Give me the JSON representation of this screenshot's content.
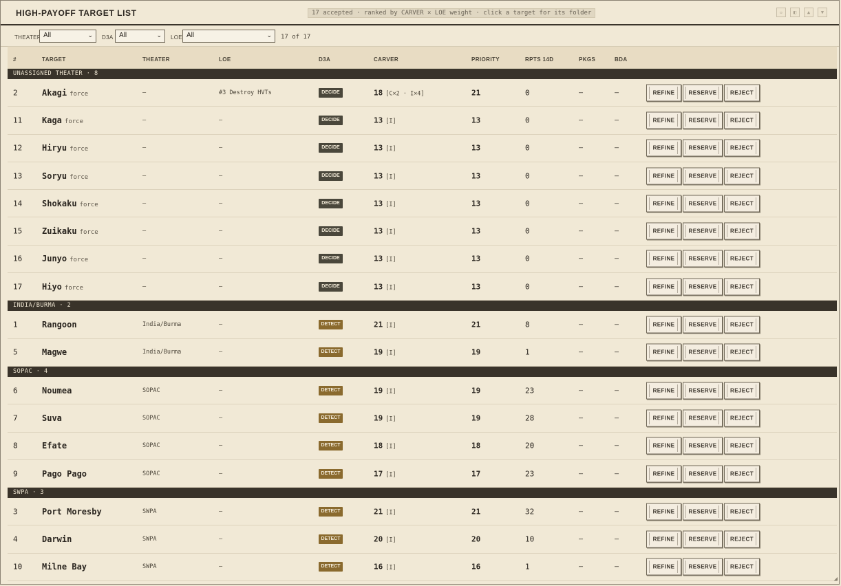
{
  "window": {
    "title": "HIGH-PAYOFF TARGET LIST",
    "subtitle": "17 accepted · ranked by CARVER × LOE weight · click a target for its folder",
    "controls": [
      "minimize-icon",
      "sidebar-icon",
      "chevron-up-icon",
      "chevron-down-icon"
    ]
  },
  "filters": {
    "theater": {
      "label": "THEATER",
      "value": "All"
    },
    "d3a": {
      "label": "D3A",
      "value": "All"
    },
    "loe": {
      "label": "LOE",
      "value": "All"
    },
    "count": "17 of 17"
  },
  "columns": [
    "#",
    "TARGET",
    "THEATER",
    "LOE",
    "D3A",
    "CARVER",
    "PRIORITY",
    "RPTS 14D",
    "PKGS",
    "BDA"
  ],
  "actions": {
    "refine": "REFINE",
    "reserve": "RESERVE",
    "reject": "REJECT"
  },
  "groups": [
    {
      "label": "UNASSIGNED THEATER · 8",
      "rows": [
        {
          "num": "2",
          "name": "Akagi",
          "sub": "force",
          "theater": "–",
          "loe": "#3 Destroy HVTs",
          "d3a": "DECIDE",
          "carver": "18",
          "carver_note": "[C×2 · I×4]",
          "priority": "21",
          "rpts": "0",
          "pkgs": "—",
          "bda": "–"
        },
        {
          "num": "11",
          "name": "Kaga",
          "sub": "force",
          "theater": "–",
          "loe": "–",
          "d3a": "DECIDE",
          "carver": "13",
          "carver_note": "[I]",
          "priority": "13",
          "rpts": "0",
          "pkgs": "—",
          "bda": "–"
        },
        {
          "num": "12",
          "name": "Hiryu",
          "sub": "force",
          "theater": "–",
          "loe": "–",
          "d3a": "DECIDE",
          "carver": "13",
          "carver_note": "[I]",
          "priority": "13",
          "rpts": "0",
          "pkgs": "—",
          "bda": "–"
        },
        {
          "num": "13",
          "name": "Soryu",
          "sub": "force",
          "theater": "–",
          "loe": "–",
          "d3a": "DECIDE",
          "carver": "13",
          "carver_note": "[I]",
          "priority": "13",
          "rpts": "0",
          "pkgs": "—",
          "bda": "–"
        },
        {
          "num": "14",
          "name": "Shokaku",
          "sub": "force",
          "theater": "–",
          "loe": "–",
          "d3a": "DECIDE",
          "carver": "13",
          "carver_note": "[I]",
          "priority": "13",
          "rpts": "0",
          "pkgs": "—",
          "bda": "–"
        },
        {
          "num": "15",
          "name": "Zuikaku",
          "sub": "force",
          "theater": "–",
          "loe": "–",
          "d3a": "DECIDE",
          "carver": "13",
          "carver_note": "[I]",
          "priority": "13",
          "rpts": "0",
          "pkgs": "—",
          "bda": "–"
        },
        {
          "num": "16",
          "name": "Junyo",
          "sub": "force",
          "theater": "–",
          "loe": "–",
          "d3a": "DECIDE",
          "carver": "13",
          "carver_note": "[I]",
          "priority": "13",
          "rpts": "0",
          "pkgs": "—",
          "bda": "–"
        },
        {
          "num": "17",
          "name": "Hiyo",
          "sub": "force",
          "theater": "–",
          "loe": "–",
          "d3a": "DECIDE",
          "carver": "13",
          "carver_note": "[I]",
          "priority": "13",
          "rpts": "0",
          "pkgs": "—",
          "bda": "–"
        }
      ]
    },
    {
      "label": "INDIA/BURMA · 2",
      "rows": [
        {
          "num": "1",
          "name": "Rangoon",
          "sub": "",
          "theater": "India/Burma",
          "loe": "–",
          "d3a": "DETECT",
          "carver": "21",
          "carver_note": "[I]",
          "priority": "21",
          "rpts": "8",
          "pkgs": "—",
          "bda": "–"
        },
        {
          "num": "5",
          "name": "Magwe",
          "sub": "",
          "theater": "India/Burma",
          "loe": "–",
          "d3a": "DETECT",
          "carver": "19",
          "carver_note": "[I]",
          "priority": "19",
          "rpts": "1",
          "pkgs": "—",
          "bda": "–"
        }
      ]
    },
    {
      "label": "SOPAC · 4",
      "rows": [
        {
          "num": "6",
          "name": "Noumea",
          "sub": "",
          "theater": "SOPAC",
          "loe": "–",
          "d3a": "DETECT",
          "carver": "19",
          "carver_note": "[I]",
          "priority": "19",
          "rpts": "23",
          "pkgs": "—",
          "bda": "–"
        },
        {
          "num": "7",
          "name": "Suva",
          "sub": "",
          "theater": "SOPAC",
          "loe": "–",
          "d3a": "DETECT",
          "carver": "19",
          "carver_note": "[I]",
          "priority": "19",
          "rpts": "28",
          "pkgs": "—",
          "bda": "–"
        },
        {
          "num": "8",
          "name": "Efate",
          "sub": "",
          "theater": "SOPAC",
          "loe": "–",
          "d3a": "DETECT",
          "carver": "18",
          "carver_note": "[I]",
          "priority": "18",
          "rpts": "20",
          "pkgs": "—",
          "bda": "–"
        },
        {
          "num": "9",
          "name": "Pago Pago",
          "sub": "",
          "theater": "SOPAC",
          "loe": "–",
          "d3a": "DETECT",
          "carver": "17",
          "carver_note": "[I]",
          "priority": "17",
          "rpts": "23",
          "pkgs": "—",
          "bda": "–"
        }
      ]
    },
    {
      "label": "SWPA · 3",
      "rows": [
        {
          "num": "3",
          "name": "Port Moresby",
          "sub": "",
          "theater": "SWPA",
          "loe": "–",
          "d3a": "DETECT",
          "carver": "21",
          "carver_note": "[I]",
          "priority": "21",
          "rpts": "32",
          "pkgs": "—",
          "bda": "–"
        },
        {
          "num": "4",
          "name": "Darwin",
          "sub": "",
          "theater": "SWPA",
          "loe": "–",
          "d3a": "DETECT",
          "carver": "20",
          "carver_note": "[I]",
          "priority": "20",
          "rpts": "10",
          "pkgs": "—",
          "bda": "–"
        },
        {
          "num": "10",
          "name": "Milne Bay",
          "sub": "",
          "theater": "SWPA",
          "loe": "–",
          "d3a": "DETECT",
          "carver": "16",
          "carver_note": "[I]",
          "priority": "16",
          "rpts": "1",
          "pkgs": "—",
          "bda": "–"
        }
      ]
    }
  ],
  "colors": {
    "decide": "#4a473b",
    "detect": "#8a6a2e",
    "group_bar": "#39332a",
    "background": "#f1e9d6"
  }
}
